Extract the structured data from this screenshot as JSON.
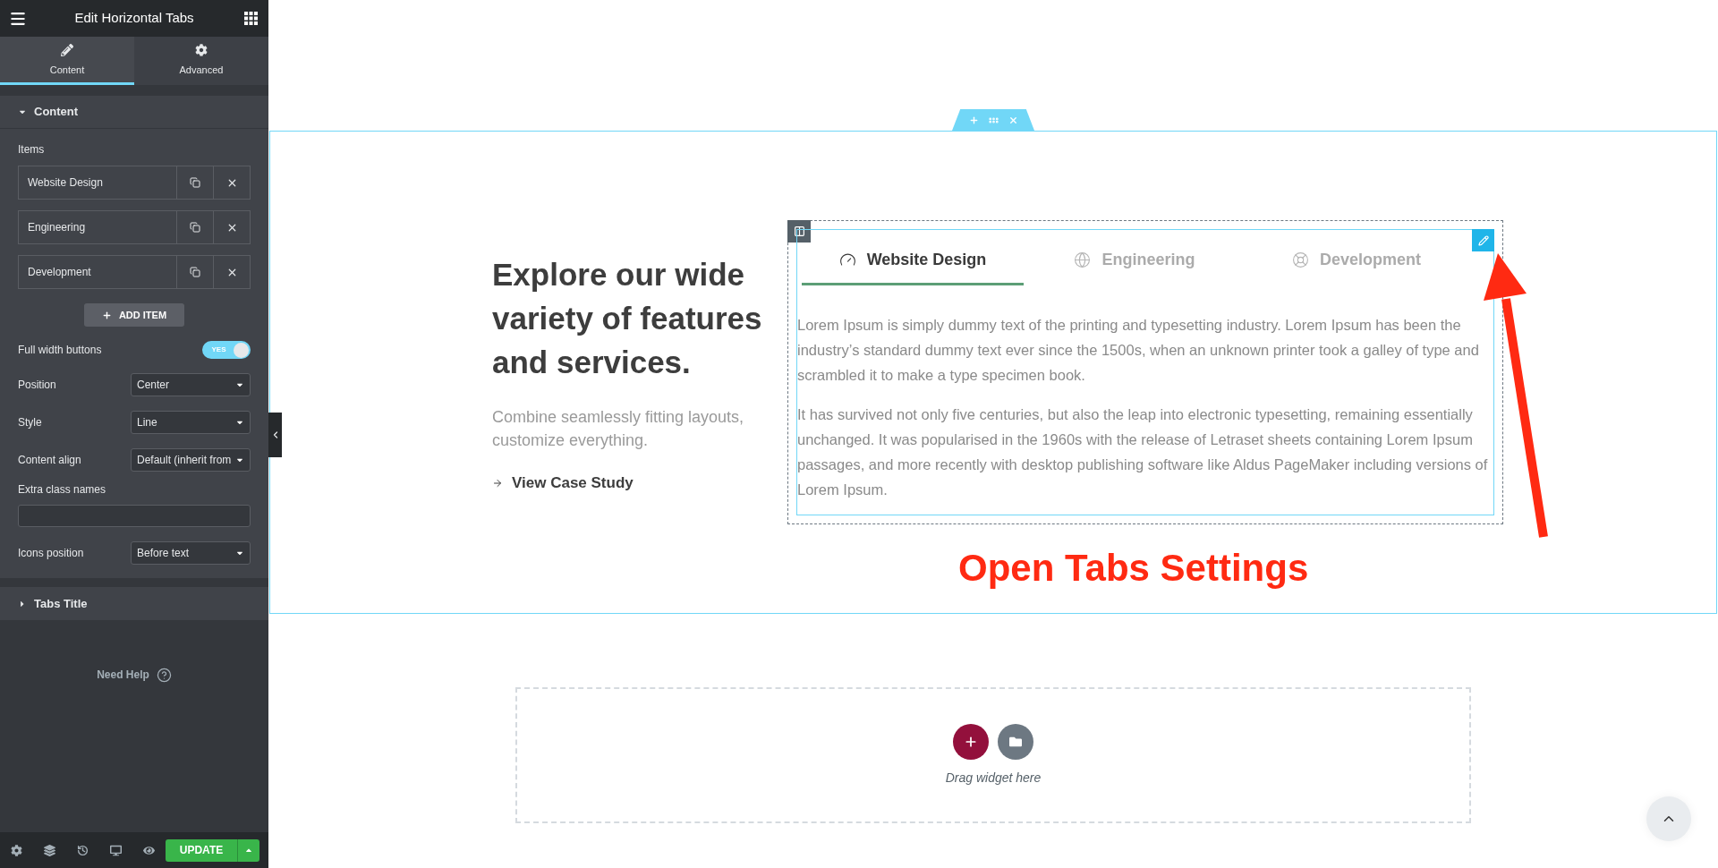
{
  "panel": {
    "title": "Edit Horizontal Tabs",
    "tabs": [
      {
        "label": "Content",
        "selected": true
      },
      {
        "label": "Advanced",
        "selected": false
      }
    ],
    "sections": [
      {
        "title": "Content",
        "expanded": true,
        "items_label": "Items",
        "items": [
          {
            "label": "Website Design"
          },
          {
            "label": "Engineering"
          },
          {
            "label": "Development"
          }
        ],
        "add_item_button": "ADD ITEM",
        "controls": [
          {
            "kind": "switch",
            "label": "Full width buttons",
            "on": true,
            "state_text": "YES"
          },
          {
            "kind": "select",
            "label": "Position",
            "value": "Center"
          },
          {
            "kind": "select",
            "label": "Style",
            "value": "Line"
          },
          {
            "kind": "select",
            "label": "Content align",
            "value": "Default (inherit from"
          },
          {
            "kind": "text",
            "label": "Extra class names"
          },
          {
            "kind": "select",
            "label": "Icons position",
            "value": "Before text"
          }
        ]
      },
      {
        "title": "Tabs Title",
        "expanded": false
      }
    ],
    "help": "Need Help",
    "update_button": "UPDATE"
  },
  "canvas": {
    "section": {
      "heading": "Explore our wide variety of features and services.",
      "subtitle": "Combine seamlessly fitting layouts, customize everything.",
      "link": "View Case Study",
      "tabs": [
        {
          "label": "Website Design",
          "selected": true
        },
        {
          "label": "Engineering",
          "selected": false
        },
        {
          "label": "Development",
          "selected": false
        }
      ],
      "paragraphs": [
        "Lorem Ipsum is simply dummy text of the printing and typesetting industry. Lorem Ipsum has been the industry’s standard dummy text ever since the 1500s, when an unknown printer took a galley of type and scrambled it to make a type specimen book.",
        "It has survived not only five centuries, but also the leap into electronic typesetting, remaining essentially unchanged. It was popularised in the 1960s with the release of Letraset sheets containing Lorem Ipsum passages, and more recently with desktop publishing software like Aldus PageMaker including versions of Lorem Ipsum."
      ]
    },
    "drop_zone": {
      "hint": "Drag widget here"
    }
  },
  "annotation": {
    "text": "Open Tabs Settings"
  }
}
